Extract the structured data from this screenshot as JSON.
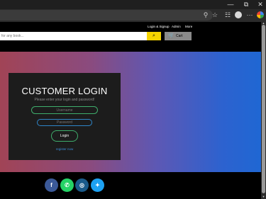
{
  "browser": {
    "window_controls": {
      "minimize": "—",
      "maximize": "⧉",
      "close": "✕"
    },
    "toolbar_icons": [
      "zoom-icon",
      "favorite-icon",
      "collections-icon",
      "profile-avatar",
      "more-icon",
      "copilot-icon"
    ],
    "more_glyph": "···"
  },
  "nav": {
    "links": [
      "Login & Signup",
      "Admin",
      "More"
    ]
  },
  "search": {
    "placeholder": "for any book...",
    "button_icon": "search-icon",
    "button_glyph": "⌕"
  },
  "cart": {
    "label": "Cart",
    "icon": "cart-icon",
    "icon_glyph": "🛒"
  },
  "login": {
    "title": "CUSTOMER LOGIN",
    "subtitle": "Please enter your login and password!",
    "username_placeholder": "Username",
    "password_placeholder": "Password",
    "button_label": "Login",
    "register_link": "register now"
  },
  "footer": {
    "social": [
      {
        "name": "facebook",
        "glyph": "f",
        "color": "#3b5998"
      },
      {
        "name": "whatsapp",
        "glyph": "✆",
        "color": "#25d366"
      },
      {
        "name": "instagram",
        "glyph": "◎",
        "color": "#1a5a8a"
      },
      {
        "name": "twitter",
        "glyph": "✦",
        "color": "#1da1f2"
      }
    ]
  },
  "colors": {
    "accent_search": "#f5d400",
    "hero_start": "#a14456",
    "hero_end": "#1f67d3",
    "card_bg": "#1c1c1c",
    "username_border": "#3fae6c",
    "password_border": "#2f86c9"
  }
}
